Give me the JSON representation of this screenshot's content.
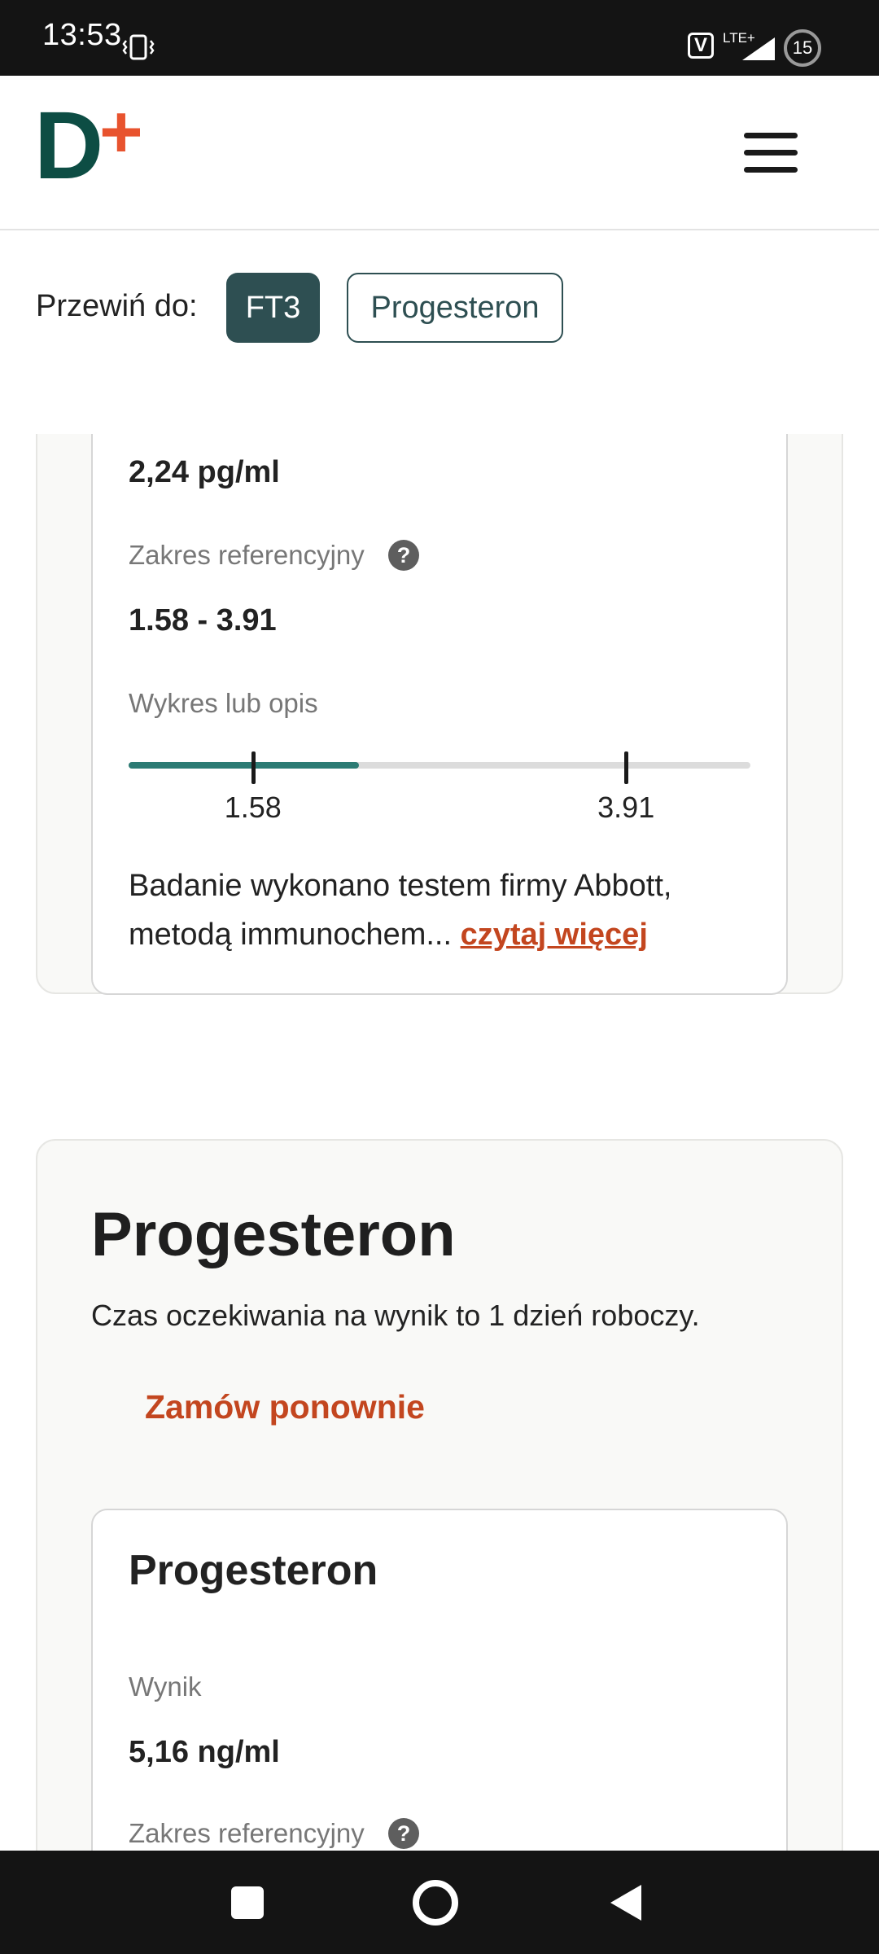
{
  "status_bar": {
    "time": "13:53",
    "network": "LTE+",
    "battery": "15",
    "icons": [
      "vibrate-icon",
      "volte-icon",
      "signal-icon",
      "battery-icon"
    ]
  },
  "header": {
    "logo_letter": "D",
    "logo_plus": "+",
    "brand_colors": {
      "letter": "#0d4d44",
      "plus": "#e8532e"
    },
    "menu_icon": "hamburger-menu-icon"
  },
  "scroll_to": {
    "label": "Przewiń do:",
    "chips": [
      {
        "label": "FT3",
        "active": true
      },
      {
        "label": "Progesteron",
        "active": false
      }
    ]
  },
  "ft3_card": {
    "result": "2,24 pg/ml",
    "reference_label": "Zakres referencyjny",
    "help_glyph": "?",
    "reference_value": "1.58 - 3.91",
    "chart_label": "Wykres lub opis",
    "range_bar": {
      "min_label": "1.58",
      "max_label": "3.91",
      "fill_fraction": 0.37,
      "min_fraction": 0.2,
      "max_fraction": 0.8,
      "fill_color": "#2c7b74"
    },
    "description": "Badanie wykonano testem firmy Abbott, metodą immunochem...",
    "read_more": "czytaj więcej"
  },
  "progesteron_card": {
    "title": "Progesteron",
    "wait_time": "Czas oczekiwania na wynik to 1 dzień roboczy.",
    "reorder_label": "Zamów ponownie",
    "inner": {
      "title": "Progesteron",
      "result_label": "Wynik",
      "result_value": "5,16 ng/ml",
      "reference_label": "Zakres referencyjny",
      "help_glyph": "?"
    }
  },
  "accent_color": "#c3461f",
  "navigation_bar": {
    "icons": [
      "recents-square-icon",
      "home-circle-icon",
      "back-triangle-icon"
    ]
  }
}
